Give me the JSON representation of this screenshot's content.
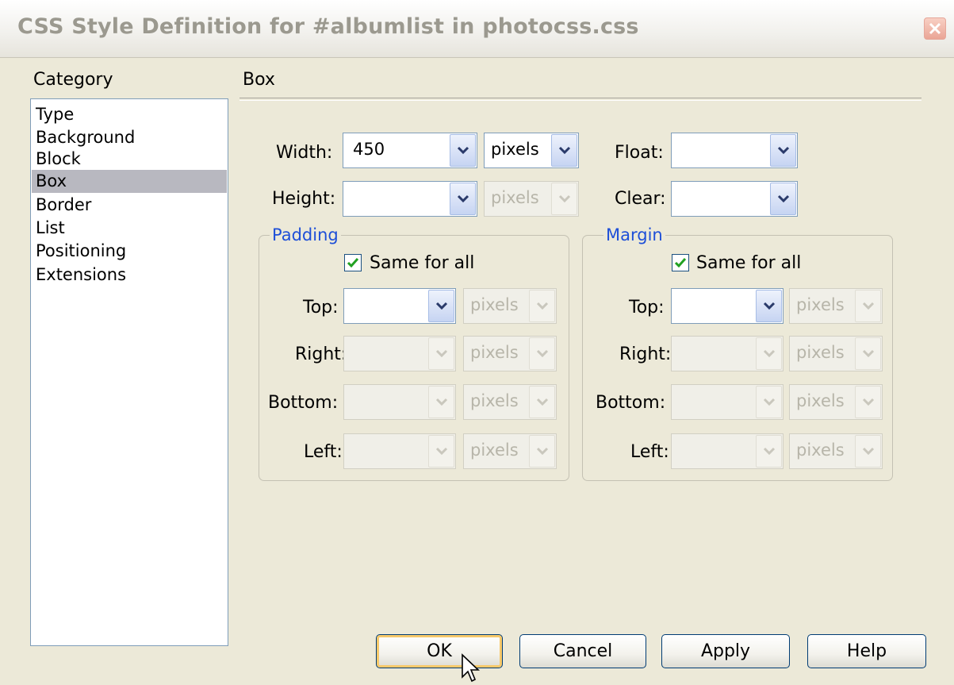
{
  "window": {
    "title": "CSS Style Definition for #albumlist in photocss.css"
  },
  "category": {
    "heading": "Category",
    "items": [
      "Type",
      "Background",
      "Block",
      "Box",
      "Border",
      "List",
      "Positioning",
      "Extensions"
    ],
    "selected": "Box"
  },
  "section": {
    "title": "Box"
  },
  "width": {
    "label": "Width:",
    "value": "450",
    "unit": "pixels"
  },
  "height": {
    "label": "Height:",
    "value": "",
    "unit": "pixels"
  },
  "float": {
    "label": "Float:",
    "value": ""
  },
  "clear": {
    "label": "Clear:",
    "value": ""
  },
  "padding": {
    "title": "Padding",
    "same_for_all": "Same for all",
    "same_checked": true,
    "top": {
      "label": "Top:",
      "value": "",
      "unit": "pixels"
    },
    "right": {
      "label": "Right:",
      "value": "",
      "unit": "pixels"
    },
    "bottom": {
      "label": "Bottom:",
      "value": "",
      "unit": "pixels"
    },
    "left": {
      "label": "Left:",
      "value": "",
      "unit": "pixels"
    }
  },
  "margin": {
    "title": "Margin",
    "same_for_all": "Same for all",
    "same_checked": true,
    "top": {
      "label": "Top:",
      "value": "",
      "unit": "pixels"
    },
    "right": {
      "label": "Right:",
      "value": "",
      "unit": "pixels"
    },
    "bottom": {
      "label": "Bottom:",
      "value": "",
      "unit": "pixels"
    },
    "left": {
      "label": "Left:",
      "value": "",
      "unit": "pixels"
    }
  },
  "buttons": {
    "ok": "OK",
    "cancel": "Cancel",
    "apply": "Apply",
    "help": "Help"
  },
  "colors": {
    "accent": "#1e4fd8",
    "selection": "#b8b8c0",
    "dialog_bg": "#ece9d8"
  }
}
